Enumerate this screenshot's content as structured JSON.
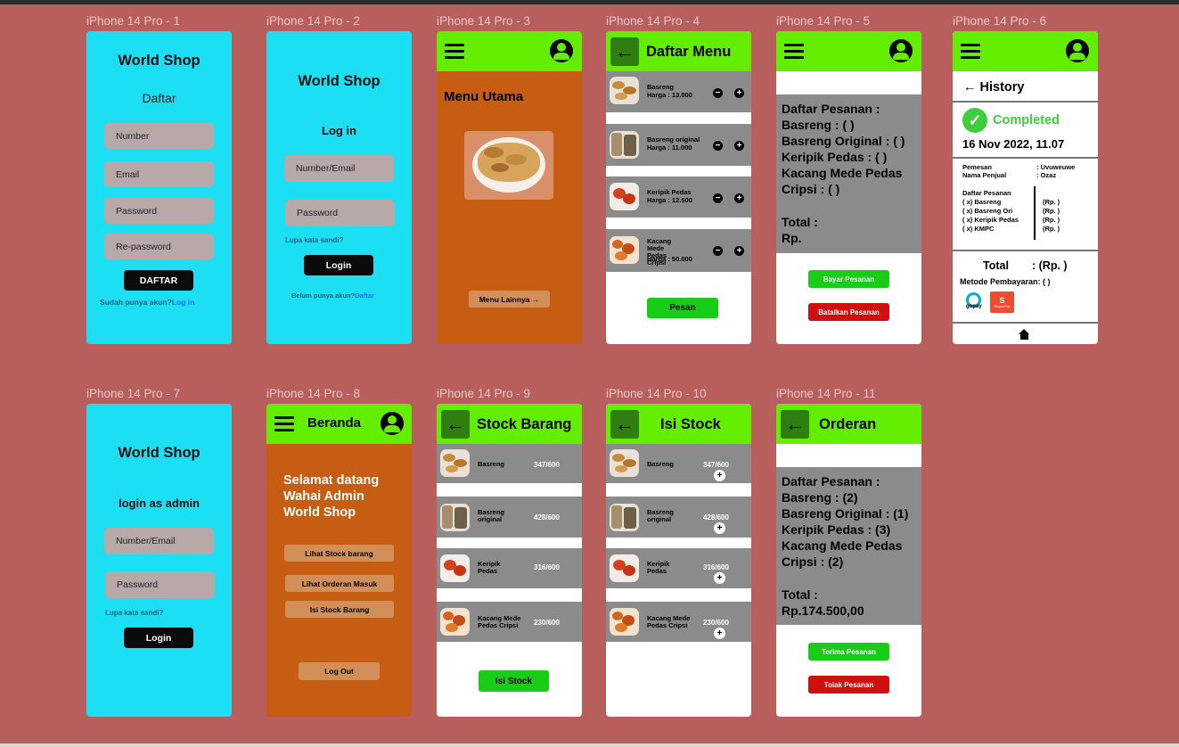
{
  "frames": {
    "f1": {
      "label": "iPhone 14 Pro - 1",
      "title": "World Shop",
      "subtitle": "Daftar",
      "number": "Number",
      "email": "Email",
      "password": "Password",
      "repassword": "Re-password",
      "button": "DAFTAR",
      "footer_text": "Sudah punya akun?",
      "footer_link": "Log in"
    },
    "f2": {
      "label": "iPhone 14 Pro - 2",
      "title": "World Shop",
      "subtitle": "Log in",
      "user": "Number/Email",
      "password": "Password",
      "forgot": "Lupa kata sandi?",
      "button": "Login",
      "footer_text": "Belum punya akun?",
      "footer_link": "Daftar"
    },
    "f3": {
      "label": "iPhone 14 Pro - 3",
      "heading": "Menu Utama",
      "more_button": "Menu Lainnya →"
    },
    "f4": {
      "label": "iPhone 14 Pro - 4",
      "title": "Daftar Menu",
      "items": [
        {
          "name": "Basreng",
          "price": "Harga : 13.000"
        },
        {
          "name": "Basreng original",
          "price": "Harga : 11.000"
        },
        {
          "name": "Keripik Pedas",
          "price": "Harga : 12.500"
        },
        {
          "name": "Kacang Mede Pedas Cripsi",
          "price": "Harga : 50.000"
        }
      ],
      "button": "Pesan"
    },
    "f5": {
      "label": "iPhone 14 Pro - 5",
      "lines": [
        "Daftar Pesanan :",
        "Basreng : ( )",
        "Basreng Original : ( )",
        "Keripik Pedas : ( )",
        "Kacang Mede Pedas",
        "Cripsi : ( )"
      ],
      "total": "Total :",
      "total_value": "Rp.",
      "pay_button": "Bayar Pesanan",
      "cancel_button": "Batalkan Pesanan"
    },
    "f6": {
      "label": "iPhone 14 Pro - 6",
      "title": "History",
      "status": "Completed",
      "date": "16 Nov 2022, 11.07",
      "pemesan_label": "Pemesan",
      "pemesan_value": ": Uvuweuwe",
      "penjual_label": "Nama Penjual",
      "penjual_value": ": Ozaz",
      "order_heading": "Daftar Pesanan",
      "order_items": [
        "( x) Basreng",
        "( x) Basreng Ori",
        "( x) Keripik Pedas",
        "( x) KMPC"
      ],
      "order_prices": [
        "(Rp. )",
        "(Rp. )",
        "(Rp. )",
        "(Rp. )"
      ],
      "total_label": "Total",
      "total_value": ": (Rp. )",
      "payment_label": "Metode Pembayaran:  ( )",
      "gopay": "gopay",
      "shopeepay": "ShopeePay"
    },
    "f7": {
      "label": "iPhone 14 Pro - 7",
      "title": "World Shop",
      "subtitle": "login as admin",
      "user": "Number/Email",
      "password": "Password",
      "forgot": "Lupa kata sandi?",
      "button": "Login"
    },
    "f8": {
      "label": "iPhone 14 Pro - 8",
      "title": "Beranda",
      "welcome": [
        "Selamat datang",
        "Wahai Admin",
        "World Shop"
      ],
      "btn_stock": "Lihat Stock barang",
      "btn_order": "Lihat Orderan Masuk",
      "btn_isi": "Isi Stock Barang",
      "btn_logout": "Log Out"
    },
    "f9": {
      "label": "iPhone 14 Pro - 9",
      "title": "Stock Barang",
      "items": [
        {
          "name": "Basreng",
          "stock": "347/600"
        },
        {
          "name": "Basreng original",
          "stock": "428/600"
        },
        {
          "name": "Keripik Pedas",
          "stock": "316/600"
        },
        {
          "name": "Kacang Mede Pedas Cripsi",
          "stock": "230/600"
        }
      ],
      "button": "Isi Stock"
    },
    "f10": {
      "label": "iPhone 14 Pro - 10",
      "title": "Isi Stock",
      "items": [
        {
          "name": "Basreng",
          "stock": "347/600"
        },
        {
          "name": "Basreng original",
          "stock": "428/600"
        },
        {
          "name": "Keripik Pedas",
          "stock": "316/600"
        },
        {
          "name": "Kacang Mede Pedas Cripsi",
          "stock": "230/600"
        }
      ]
    },
    "f11": {
      "label": "iPhone 14 Pro - 11",
      "title": "Orderan",
      "lines": [
        "Daftar Pesanan :",
        "Basreng : (2)",
        "Basreng Original : (1)",
        "Keripik Pedas : (3)",
        "Kacang Mede Pedas",
        "Cripsi : (2)"
      ],
      "total": "Total :",
      "total_value": "Rp.174.500,00",
      "accept_button": "Terima Pesanan",
      "reject_button": "Tolak Pesanan"
    }
  },
  "colors": {
    "canvas": "#b85f5e",
    "cyan": "#1ddff4",
    "orange": "#c65d12",
    "green": "#63ee00",
    "grey": "#8b8b8b",
    "button_green": "#18cc18",
    "button_red": "#d01010"
  },
  "icons": [
    "menu-icon",
    "profile-icon",
    "back-arrow-icon",
    "plus-icon",
    "minus-icon",
    "check-circle-icon",
    "home-icon"
  ]
}
